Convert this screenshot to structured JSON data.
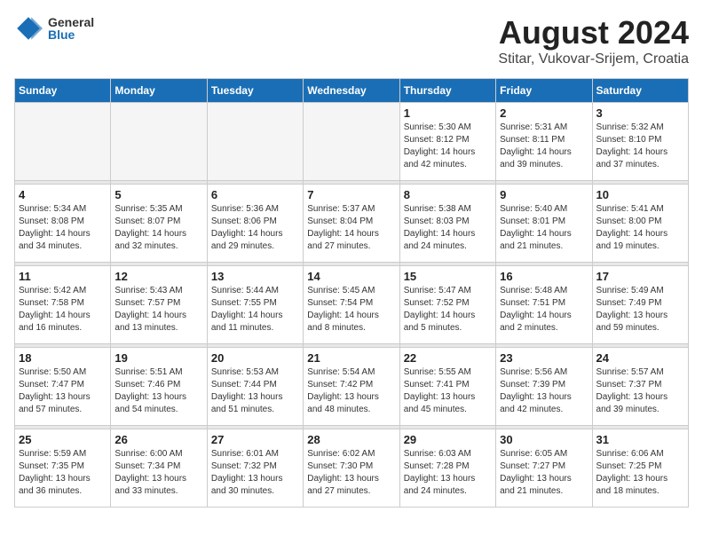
{
  "logo": {
    "general": "General",
    "blue": "Blue"
  },
  "title": "August 2024",
  "location": "Stitar, Vukovar-Srijem, Croatia",
  "days_of_week": [
    "Sunday",
    "Monday",
    "Tuesday",
    "Wednesday",
    "Thursday",
    "Friday",
    "Saturday"
  ],
  "weeks": [
    {
      "days": [
        {
          "number": "",
          "empty": true
        },
        {
          "number": "",
          "empty": true
        },
        {
          "number": "",
          "empty": true
        },
        {
          "number": "",
          "empty": true
        },
        {
          "number": "1",
          "sunrise": "5:30 AM",
          "sunset": "8:12 PM",
          "daylight": "14 hours and 42 minutes."
        },
        {
          "number": "2",
          "sunrise": "5:31 AM",
          "sunset": "8:11 PM",
          "daylight": "14 hours and 39 minutes."
        },
        {
          "number": "3",
          "sunrise": "5:32 AM",
          "sunset": "8:10 PM",
          "daylight": "14 hours and 37 minutes."
        }
      ]
    },
    {
      "days": [
        {
          "number": "4",
          "sunrise": "5:34 AM",
          "sunset": "8:08 PM",
          "daylight": "14 hours and 34 minutes."
        },
        {
          "number": "5",
          "sunrise": "5:35 AM",
          "sunset": "8:07 PM",
          "daylight": "14 hours and 32 minutes."
        },
        {
          "number": "6",
          "sunrise": "5:36 AM",
          "sunset": "8:06 PM",
          "daylight": "14 hours and 29 minutes."
        },
        {
          "number": "7",
          "sunrise": "5:37 AM",
          "sunset": "8:04 PM",
          "daylight": "14 hours and 27 minutes."
        },
        {
          "number": "8",
          "sunrise": "5:38 AM",
          "sunset": "8:03 PM",
          "daylight": "14 hours and 24 minutes."
        },
        {
          "number": "9",
          "sunrise": "5:40 AM",
          "sunset": "8:01 PM",
          "daylight": "14 hours and 21 minutes."
        },
        {
          "number": "10",
          "sunrise": "5:41 AM",
          "sunset": "8:00 PM",
          "daylight": "14 hours and 19 minutes."
        }
      ]
    },
    {
      "days": [
        {
          "number": "11",
          "sunrise": "5:42 AM",
          "sunset": "7:58 PM",
          "daylight": "14 hours and 16 minutes."
        },
        {
          "number": "12",
          "sunrise": "5:43 AM",
          "sunset": "7:57 PM",
          "daylight": "14 hours and 13 minutes."
        },
        {
          "number": "13",
          "sunrise": "5:44 AM",
          "sunset": "7:55 PM",
          "daylight": "14 hours and 11 minutes."
        },
        {
          "number": "14",
          "sunrise": "5:45 AM",
          "sunset": "7:54 PM",
          "daylight": "14 hours and 8 minutes."
        },
        {
          "number": "15",
          "sunrise": "5:47 AM",
          "sunset": "7:52 PM",
          "daylight": "14 hours and 5 minutes."
        },
        {
          "number": "16",
          "sunrise": "5:48 AM",
          "sunset": "7:51 PM",
          "daylight": "14 hours and 2 minutes."
        },
        {
          "number": "17",
          "sunrise": "5:49 AM",
          "sunset": "7:49 PM",
          "daylight": "13 hours and 59 minutes."
        }
      ]
    },
    {
      "days": [
        {
          "number": "18",
          "sunrise": "5:50 AM",
          "sunset": "7:47 PM",
          "daylight": "13 hours and 57 minutes."
        },
        {
          "number": "19",
          "sunrise": "5:51 AM",
          "sunset": "7:46 PM",
          "daylight": "13 hours and 54 minutes."
        },
        {
          "number": "20",
          "sunrise": "5:53 AM",
          "sunset": "7:44 PM",
          "daylight": "13 hours and 51 minutes."
        },
        {
          "number": "21",
          "sunrise": "5:54 AM",
          "sunset": "7:42 PM",
          "daylight": "13 hours and 48 minutes."
        },
        {
          "number": "22",
          "sunrise": "5:55 AM",
          "sunset": "7:41 PM",
          "daylight": "13 hours and 45 minutes."
        },
        {
          "number": "23",
          "sunrise": "5:56 AM",
          "sunset": "7:39 PM",
          "daylight": "13 hours and 42 minutes."
        },
        {
          "number": "24",
          "sunrise": "5:57 AM",
          "sunset": "7:37 PM",
          "daylight": "13 hours and 39 minutes."
        }
      ]
    },
    {
      "days": [
        {
          "number": "25",
          "sunrise": "5:59 AM",
          "sunset": "7:35 PM",
          "daylight": "13 hours and 36 minutes."
        },
        {
          "number": "26",
          "sunrise": "6:00 AM",
          "sunset": "7:34 PM",
          "daylight": "13 hours and 33 minutes."
        },
        {
          "number": "27",
          "sunrise": "6:01 AM",
          "sunset": "7:32 PM",
          "daylight": "13 hours and 30 minutes."
        },
        {
          "number": "28",
          "sunrise": "6:02 AM",
          "sunset": "7:30 PM",
          "daylight": "13 hours and 27 minutes."
        },
        {
          "number": "29",
          "sunrise": "6:03 AM",
          "sunset": "7:28 PM",
          "daylight": "13 hours and 24 minutes."
        },
        {
          "number": "30",
          "sunrise": "6:05 AM",
          "sunset": "7:27 PM",
          "daylight": "13 hours and 21 minutes."
        },
        {
          "number": "31",
          "sunrise": "6:06 AM",
          "sunset": "7:25 PM",
          "daylight": "13 hours and 18 minutes."
        }
      ]
    }
  ]
}
